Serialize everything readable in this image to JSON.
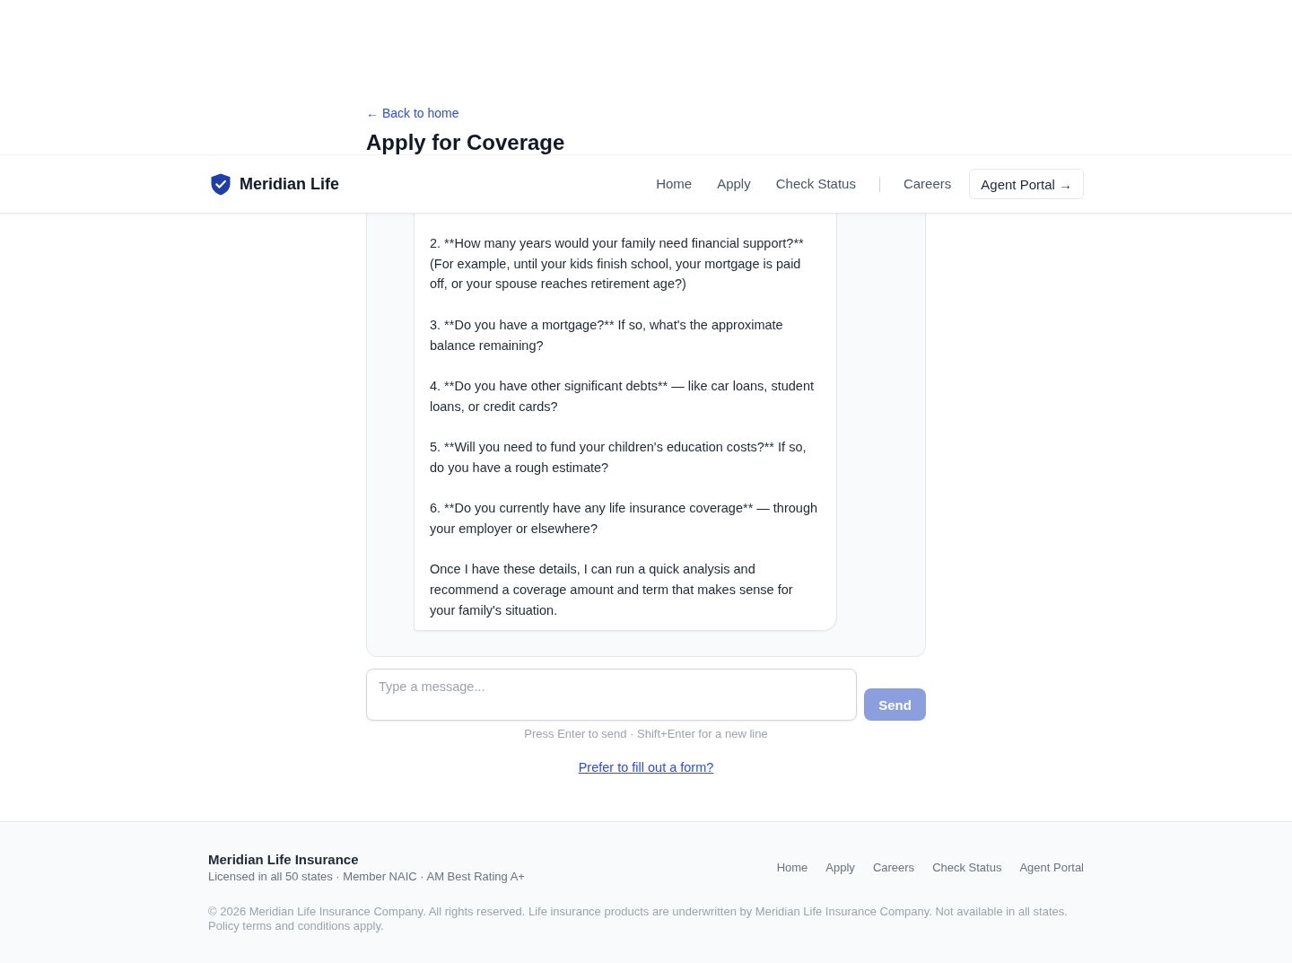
{
  "back_link": {
    "label": "← Back to home"
  },
  "page_title": "Apply for Coverage",
  "header": {
    "brand": "Meridian Life",
    "nav": [
      {
        "label": "Home"
      },
      {
        "label": "Apply"
      },
      {
        "label": "Check Status"
      }
    ],
    "secondary_nav": [
      {
        "label": "Careers"
      }
    ],
    "portal_button": {
      "label": "Agent Portal →"
    }
  },
  "chat": {
    "messages": [
      {
        "kind": "assistant",
        "paragraphs": [
          "2. **How many years would your family need financial support?** (For example, until your kids finish school, your mortgage is paid off, or your spouse reaches retirement age?)",
          "3. **Do you have a mortgage?** If so, what's the approximate balance remaining?",
          "4. **Do you have other significant debts** — like car loans, student loans, or credit cards?",
          "5. **Will you need to fund your children's education costs?** If so, do you have a rough estimate?",
          "6. **Do you currently have any life insurance coverage** — through your employer or elsewhere?",
          "Once I have these details, I can run a quick analysis and recommend a coverage amount and term that makes sense for your family's situation."
        ]
      }
    ],
    "composer": {
      "placeholder": "Type a message...",
      "send_button": {
        "label": "Send",
        "disabled": true
      }
    },
    "hint": "Press Enter to send · Shift+Enter for a new line",
    "form_link": "Prefer to fill out a form?"
  },
  "footer": {
    "company": "Meridian Life Insurance",
    "credentials": "Licensed in all 50 states · Member NAIC · AM Best Rating A+",
    "links": [
      {
        "label": "Home"
      },
      {
        "label": "Apply"
      },
      {
        "label": "Careers"
      },
      {
        "label": "Check Status"
      },
      {
        "label": "Agent Portal"
      }
    ],
    "legal": "© 2026 Meridian Life Insurance Company. All rights reserved. Life insurance products are underwritten by Meridian Life Insurance Company. Not available in all states. Policy terms and conditions apply."
  }
}
